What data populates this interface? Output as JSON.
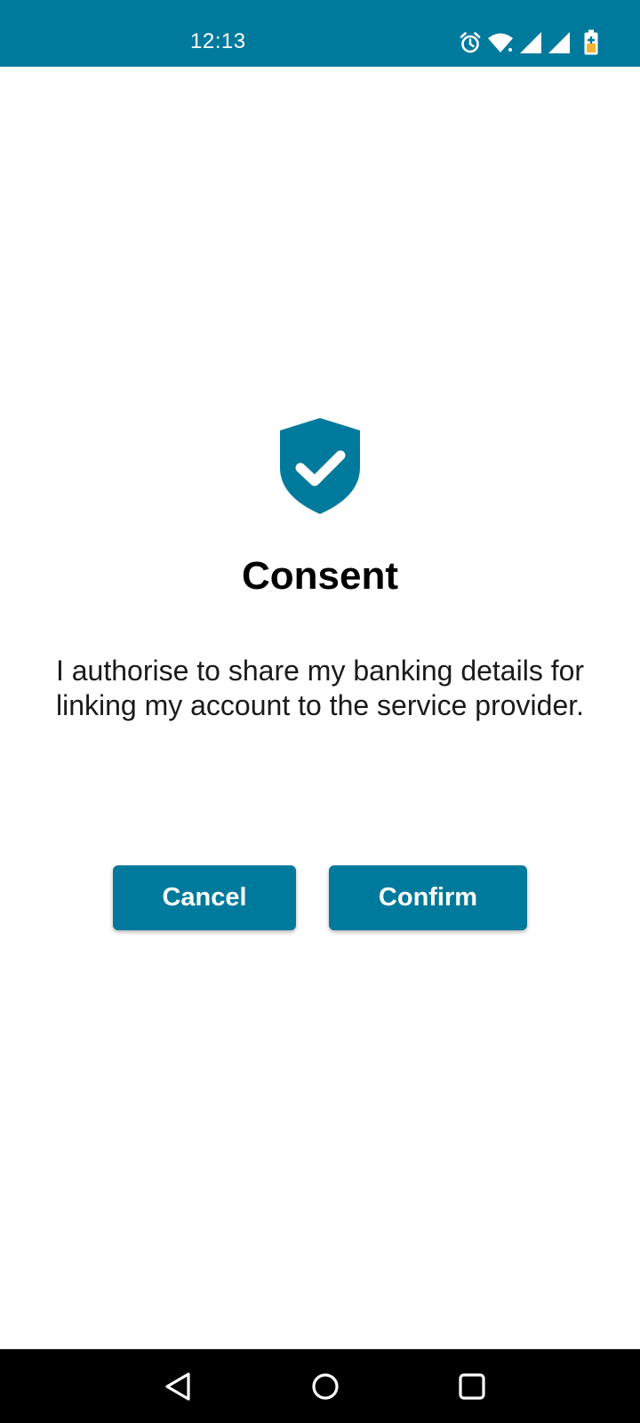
{
  "status_bar": {
    "time": "12:13",
    "background": "#007a9c",
    "icons": [
      "alarm-icon",
      "wifi-icon",
      "signal-icon",
      "signal-icon",
      "battery-charging-icon"
    ]
  },
  "consent": {
    "icon": "shield-check-icon",
    "title": "Consent",
    "message": "I authorise to share my banking details for linking my account to the service provider.",
    "accent": "#007a9c"
  },
  "actions": {
    "cancel_label": "Cancel",
    "confirm_label": "Confirm"
  },
  "navigation": {
    "icons": [
      "back-icon",
      "home-icon",
      "recents-icon"
    ]
  }
}
